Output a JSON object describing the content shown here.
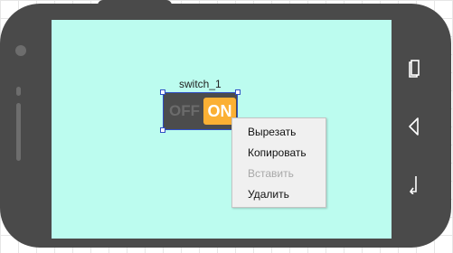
{
  "widget": {
    "name_label": "switch_1",
    "off_label": "OFF",
    "on_label": "ON",
    "state": "on"
  },
  "context_menu": {
    "items": [
      {
        "label": "Вырезать",
        "enabled": true
      },
      {
        "label": "Копировать",
        "enabled": true
      },
      {
        "label": "Вставить",
        "enabled": false
      },
      {
        "label": "Удалить",
        "enabled": true
      }
    ]
  },
  "device_nav": {
    "icons": [
      "recent-apps-icon",
      "back-icon",
      "home-icon"
    ]
  },
  "colors": {
    "screen_bg": "#bcfcef",
    "phone_frame": "#4a4a4a",
    "switch_on": "#fbb034",
    "selection": "#2f4fc4",
    "menu_bg": "#f0f0f0"
  }
}
